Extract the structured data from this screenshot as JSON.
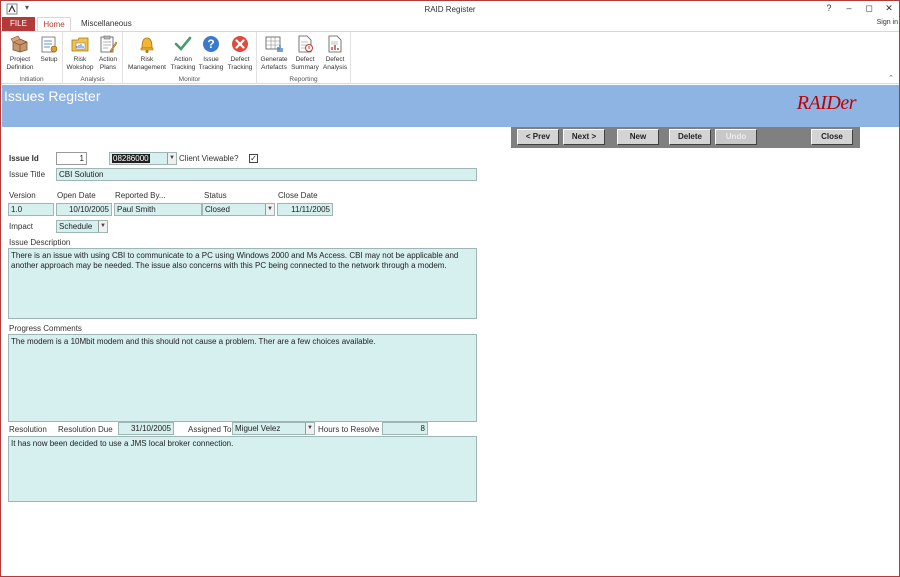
{
  "window": {
    "title": "RAID Register",
    "help": "?",
    "minimize": "–",
    "restore": "◻",
    "close": "✕",
    "sign_in": "Sign in"
  },
  "ribbon_tabs": {
    "file": "FILE",
    "home": "Home",
    "misc": "Miscellaneous"
  },
  "ribbon": {
    "groups": {
      "initiation": "Initiation",
      "analysis": "Analysis",
      "monitor": "Monitor",
      "reporting": "Reporting"
    },
    "buttons": {
      "project_definition": [
        "Project",
        "Definition"
      ],
      "setup": [
        "Setup",
        ""
      ],
      "risk_wokshop": [
        "Risk",
        "Wokshop"
      ],
      "action_plans": [
        "Action",
        "Plans"
      ],
      "risk_management": [
        "Risk",
        "Management"
      ],
      "action_tracking": [
        "Action",
        "Tracking"
      ],
      "issue_tracking": [
        "Issue",
        "Tracking"
      ],
      "defect_tracking": [
        "Defect",
        "Tracking"
      ],
      "generate_artefacts": [
        "Generate",
        "Artefacts"
      ],
      "defect_summary": [
        "Defect",
        "Summary"
      ],
      "defect_analysis": [
        "Defect",
        "Analysis"
      ]
    }
  },
  "header": {
    "title": "Issues Register",
    "logo": "RAIDer"
  },
  "nav": {
    "prev": "< Prev",
    "next": "Next >",
    "new": "New",
    "delete": "Delete",
    "undo": "Undo",
    "close": "Close"
  },
  "form": {
    "issue_id_label": "Issue Id",
    "issue_id": "1",
    "ref_code": "08286000",
    "client_viewable_label": "Client Viewable?",
    "client_viewable_mark": "✓",
    "issue_title_label": "Issue Title",
    "issue_title": "CBI Solution",
    "version_label": "Version",
    "version": "1.0",
    "open_date_label": "Open Date",
    "open_date": "10/10/2005",
    "reported_by_label": "Reported By...",
    "reported_by": "Paul Smith",
    "status_label": "Status",
    "status": "Closed",
    "close_date_label": "Close Date",
    "close_date": "11/11/2005",
    "impact_label": "Impact",
    "impact": "Schedule",
    "issue_description_label": "Issue Description",
    "issue_description": "There is an issue with using CBI to communicate to a PC using Windows 2000 and Ms Access. CBI may not be applicable and another approach may be needed. The issue also concerns with this PC being connected to the network through a modem.",
    "progress_comments_label": "Progress Comments",
    "progress_comments": "The modem is a 10Mbit modem and this should not cause a problem. Ther are a few choices available.",
    "resolution_label": "Resolution",
    "resolution_due_label": "Resolution Due",
    "resolution_due": "31/10/2005",
    "assigned_to_label": "Assigned To",
    "assigned_to": "Miguel Velez",
    "hours_label": "Hours to Resolve",
    "hours": "8",
    "resolution": "It has now been decided to use a JMS local broker connection."
  },
  "colors": {
    "accent": "#b33a3a",
    "header_band": "#8eb4e3",
    "field_bg": "#d6f0ef",
    "logo": "#c00000"
  }
}
